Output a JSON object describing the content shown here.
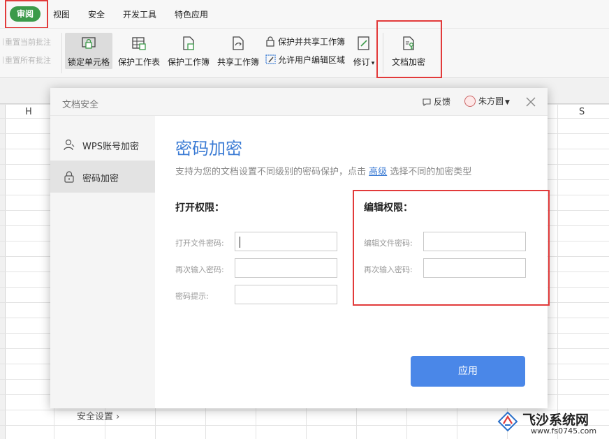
{
  "ribbon": {
    "tabs": [
      "审阅",
      "视图",
      "安全",
      "开发工具",
      "特色应用"
    ],
    "active_tab": "审阅"
  },
  "toolbar": {
    "reset_current": "重置当前批注",
    "reset_all": "重置所有批注",
    "lock_cell": "锁定单元格",
    "protect_sheet": "保护工作表",
    "protect_book": "保护工作簿",
    "share_book": "共享工作簿",
    "protect_share": "保护并共享工作簿",
    "allow_edit": "允许用户编辑区域",
    "revise": "修订",
    "doc_encrypt": "文档加密"
  },
  "sheet": {
    "col_left": "H",
    "col_right": "S"
  },
  "dialog": {
    "title": "文档安全",
    "feedback": "反馈",
    "user": "朱方圆",
    "sidebar": [
      {
        "label": "WPS账号加密",
        "icon": "user-icon"
      },
      {
        "label": "密码加密",
        "icon": "lock-icon"
      }
    ],
    "security_settings": "安全设置",
    "heading": "密码加密",
    "desc_prefix": "支持为您的文档设置不同级别的密码保护，点击",
    "desc_link": "高级",
    "desc_suffix": "选择不同的加密类型",
    "open_section": {
      "title": "打开权限：",
      "open_password": "打开文件密码:",
      "confirm_password": "再次输入密码:",
      "hint": "密码提示:"
    },
    "edit_section": {
      "title": "编辑权限：",
      "edit_password": "编辑文件密码:",
      "confirm_password": "再次输入密码:"
    },
    "apply": "应用"
  },
  "watermark": {
    "name": "飞沙系统网",
    "url": "www.fs0745.com"
  },
  "colors": {
    "accent": "#3b7bd4",
    "apply": "#4a87e8",
    "highlight": "#e23a3a",
    "tab_active": "#3b9a49"
  }
}
